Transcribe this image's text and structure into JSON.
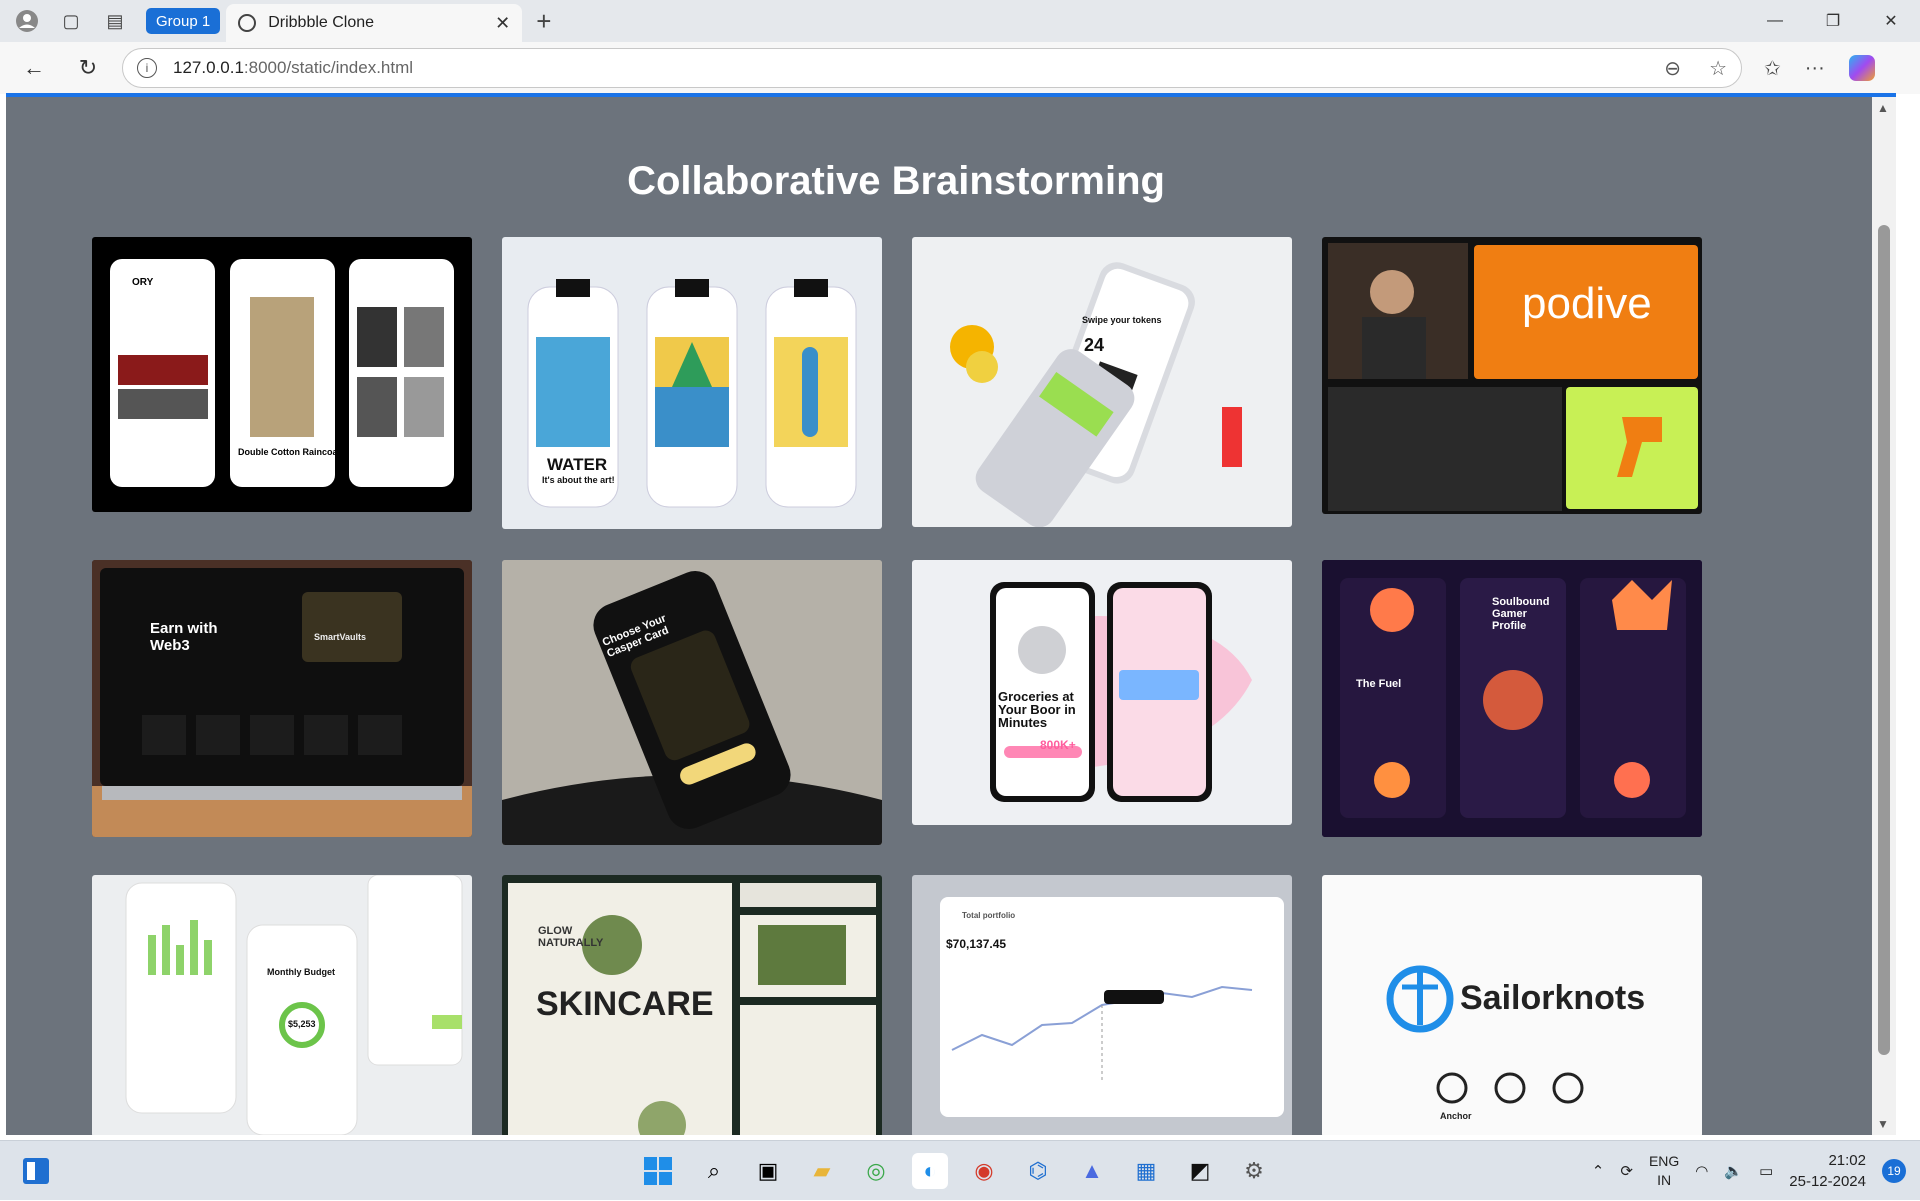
{
  "browser": {
    "tab_group": "Group 1",
    "tab_title": "Dribbble Clone",
    "url_host": "127.0.0.1",
    "url_path": ":8000/static/index.html"
  },
  "page": {
    "title": "Collaborative Brainstorming",
    "cards": [
      {
        "label": "ORY",
        "subtitle": "Double Cotton Raincoat"
      },
      {
        "label": "WATER",
        "subtitle": "It's about the art!"
      },
      {
        "label": "Swipe your tokens",
        "subtitle": "24"
      },
      {
        "label": "podive",
        "subtitle": ""
      },
      {
        "label": "Earn with Web3",
        "subtitle": "SmartVaults"
      },
      {
        "label": "Choose Your Casper Card",
        "subtitle": ""
      },
      {
        "label": "Groceries at Your Boor in Minutes",
        "subtitle": "800K+"
      },
      {
        "label": "Soulbound Gamer Profile",
        "subtitle": "The Fuel"
      },
      {
        "label": "Monthly Budget",
        "subtitle": "$5,253"
      },
      {
        "label": "SKINCARE",
        "subtitle": "GLOW NATURALLY"
      },
      {
        "label": "$70,137.45",
        "subtitle": "Total portfolio"
      },
      {
        "label": "Sailorknots",
        "subtitle": "Anchor"
      }
    ]
  },
  "taskbar": {
    "lang_top": "ENG",
    "lang_bottom": "IN",
    "time": "21:02",
    "date": "25-12-2024",
    "notifications": "19"
  }
}
